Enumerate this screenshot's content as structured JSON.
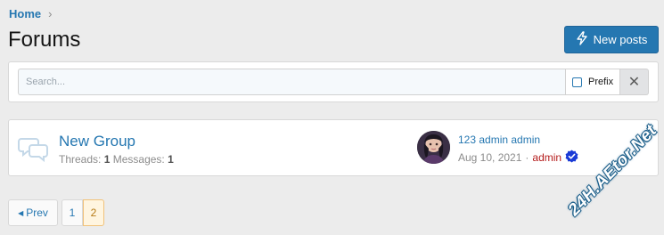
{
  "breadcrumb": {
    "home": "Home",
    "separator": "›"
  },
  "page_title": "Forums",
  "new_posts_button": {
    "label": "New posts",
    "icon": "bolt-icon"
  },
  "filter": {
    "search_placeholder": "Search...",
    "prefix_label": "Prefix",
    "clear_glyph": "✕"
  },
  "node": {
    "title": "New Group",
    "threads_label": "Threads:",
    "threads_value": "1",
    "messages_label": "Messages:",
    "messages_value": "1",
    "last_post": {
      "title": "123 admin admin",
      "date": "Aug 10, 2021",
      "separator": "·",
      "user": "admin"
    }
  },
  "pagination": {
    "prev_label": "Prev",
    "pages": [
      "1",
      "2"
    ],
    "current": "2"
  },
  "watermark": "24H.AEtor.Net",
  "colors": {
    "accent": "#2577b1",
    "user_highlight": "#b41b1b",
    "current_page_bg": "#fff5e0"
  }
}
